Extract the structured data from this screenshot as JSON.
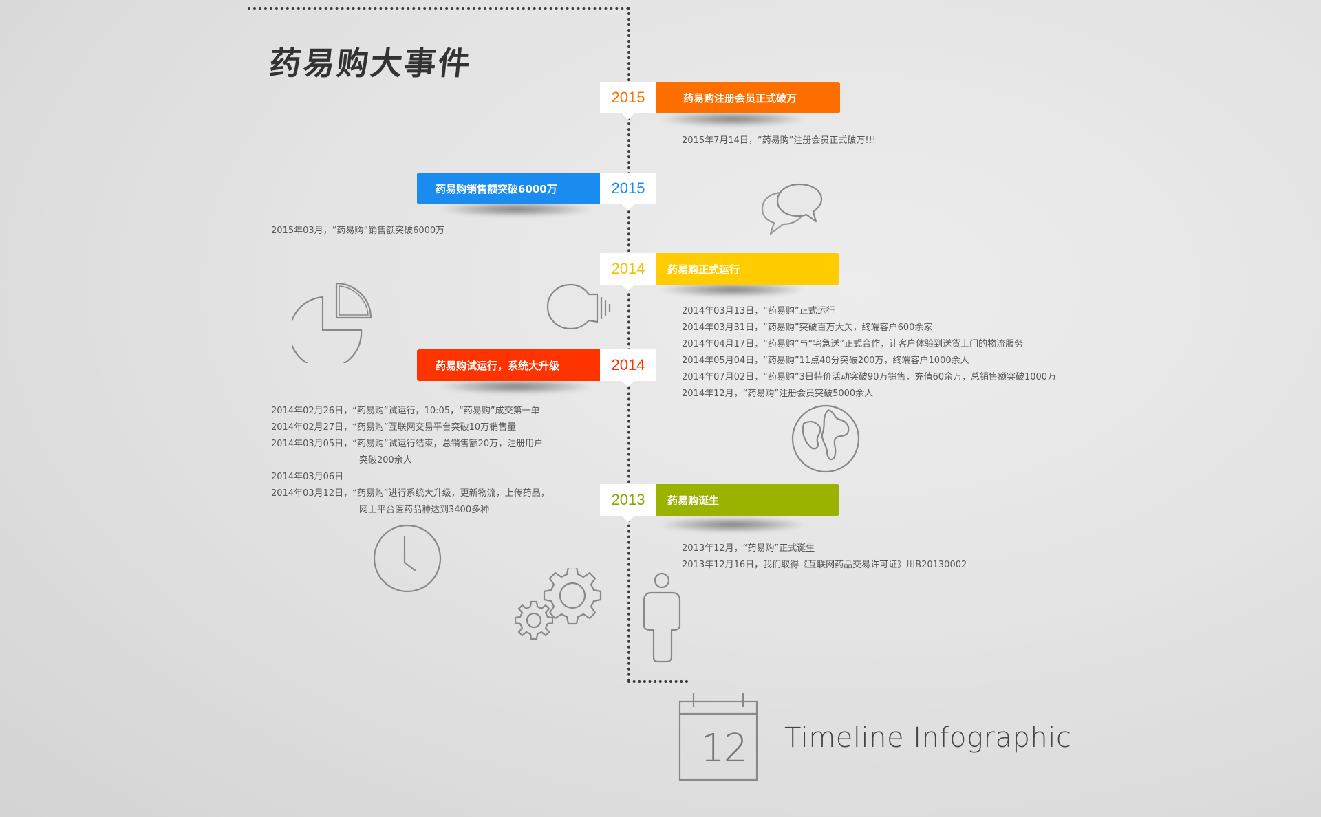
{
  "title": "药易购大事件",
  "events": [
    {
      "year": "2015",
      "label": "药易购注册会员正式破万",
      "color": "#ff6f00"
    },
    {
      "year": "2015",
      "label": "药易购销售额突破6000万",
      "color": "#1a8cf0"
    },
    {
      "year": "2014",
      "label": "药易购正式运行",
      "color": "#ffcc00"
    },
    {
      "year": "2014",
      "label": "药易购试运行，系统大升级",
      "color": "#ff3300"
    },
    {
      "year": "2013",
      "label": "药易购诞生",
      "color": "#99b300"
    }
  ],
  "details": {
    "e1": [
      "2015年7月14日，“药易购”注册会员正式破万!!!"
    ],
    "e2": [
      "2015年03月，“药易购”销售额突破6000万"
    ],
    "e3": [
      "2014年03月13日，“药易购”正式运行",
      "2014年03月31日，“药易购”突破百万大关，终端客户600余家",
      "2014年04月17日，“药易购”与“宅急送”正式合作，让客户体验到送货上门的物流服务",
      "2014年05月04日，“药易购”11点40分突破200万，终端客户1000余人",
      "2014年07月02日，“药易购”3日特价活动突破90万销售，充值60余万，总销售额突破1000万",
      "2014年12月，“药易购”注册会员突破5000余人"
    ],
    "e4": [
      "2014年02月26日，“药易购”试运行，10:05，“药易购”成交第一单",
      "2014年02月27日，“药易购”互联网交易平台突破10万销售量",
      "2014年03月05日，“药易购”试运行结束，总销售额20万，注册用户",
      "突破200余人",
      "2014年03月06日—",
      "2014年03月12日，“药易购”进行系统大升级，更新物流，上传药品，",
      "网上平台医药品种达到3400多种"
    ],
    "e5": [
      "2013年12月，“药易购”正式诞生",
      "2013年12月16日，我们取得《互联网药品交易许可证》川B20130002"
    ]
  },
  "calendar_number": "12",
  "brand": "Timeline Infographic",
  "icons": [
    "chat-bubbles-icon",
    "pie-chart-icon",
    "lightbulb-icon",
    "globe-icon",
    "clock-icon",
    "gears-icon",
    "person-icon",
    "calendar-icon"
  ]
}
